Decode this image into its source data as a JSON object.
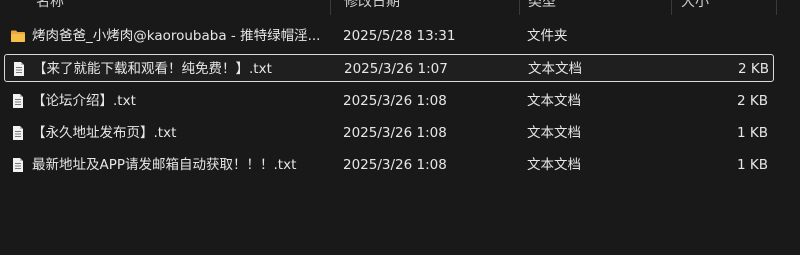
{
  "header": {
    "name_label": "名称",
    "date_label": "修改日期",
    "type_label": "类型",
    "size_label": "大小"
  },
  "colors": {
    "background": "#191919",
    "folder": "#f4c04a",
    "selection_border": "#d9d9d9"
  },
  "files": [
    {
      "name": "烤肉爸爸_小烤肉@kaoroubaba - 推特绿帽淫...",
      "date": "2025/5/28 13:31",
      "type": "文件夹",
      "size": "",
      "icon": "folder-icon"
    },
    {
      "name": "【来了就能下载和观看！纯免费！】.txt",
      "date": "2025/3/26 1:07",
      "type": "文本文档",
      "size": "2 KB",
      "icon": "text-file-icon",
      "selected": true
    },
    {
      "name": "【论坛介绍】.txt",
      "date": "2025/3/26 1:08",
      "type": "文本文档",
      "size": "2 KB",
      "icon": "text-file-icon"
    },
    {
      "name": "【永久地址发布页】.txt",
      "date": "2025/3/26 1:08",
      "type": "文本文档",
      "size": "1 KB",
      "icon": "text-file-icon"
    },
    {
      "name": "最新地址及APP请发邮箱自动获取！！！.txt",
      "date": "2025/3/26 1:08",
      "type": "文本文档",
      "size": "1 KB",
      "icon": "text-file-icon"
    }
  ]
}
